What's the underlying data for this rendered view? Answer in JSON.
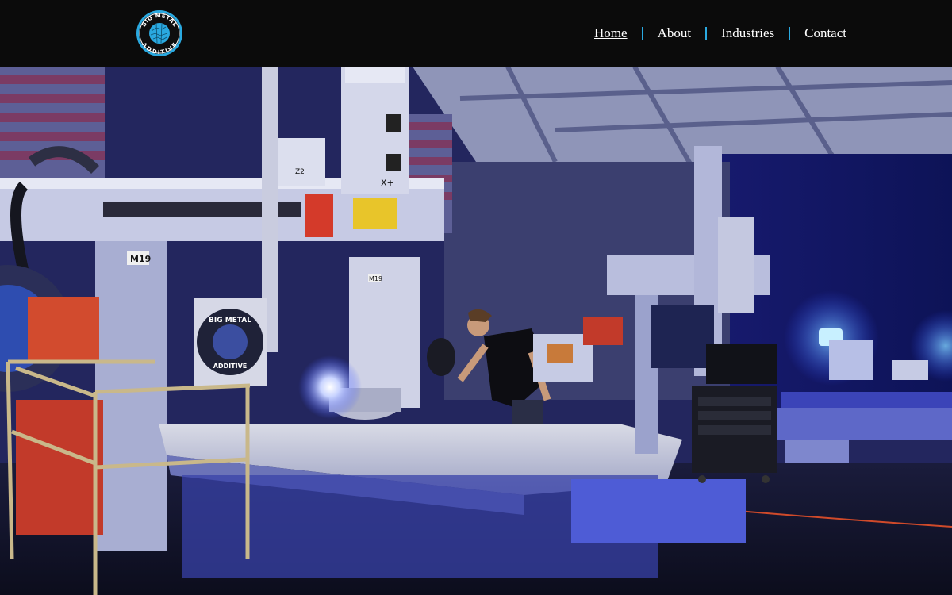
{
  "brand": {
    "logo_text_top": "BIG METAL",
    "logo_text_bottom": "ADDITIVE",
    "accent": "#2aa9e0"
  },
  "nav": {
    "items": [
      {
        "label": "Home",
        "active": true
      },
      {
        "label": "About",
        "active": false
      },
      {
        "label": "Industries",
        "active": false
      },
      {
        "label": "Contact",
        "active": false
      }
    ]
  },
  "hero": {
    "machine_label_left": "M19",
    "machine_label_center": "M19",
    "axis_label": "Z2",
    "axis_label_x": "X+",
    "wall_logo_top": "BIG METAL",
    "wall_logo_bottom": "ADDITIVE"
  }
}
